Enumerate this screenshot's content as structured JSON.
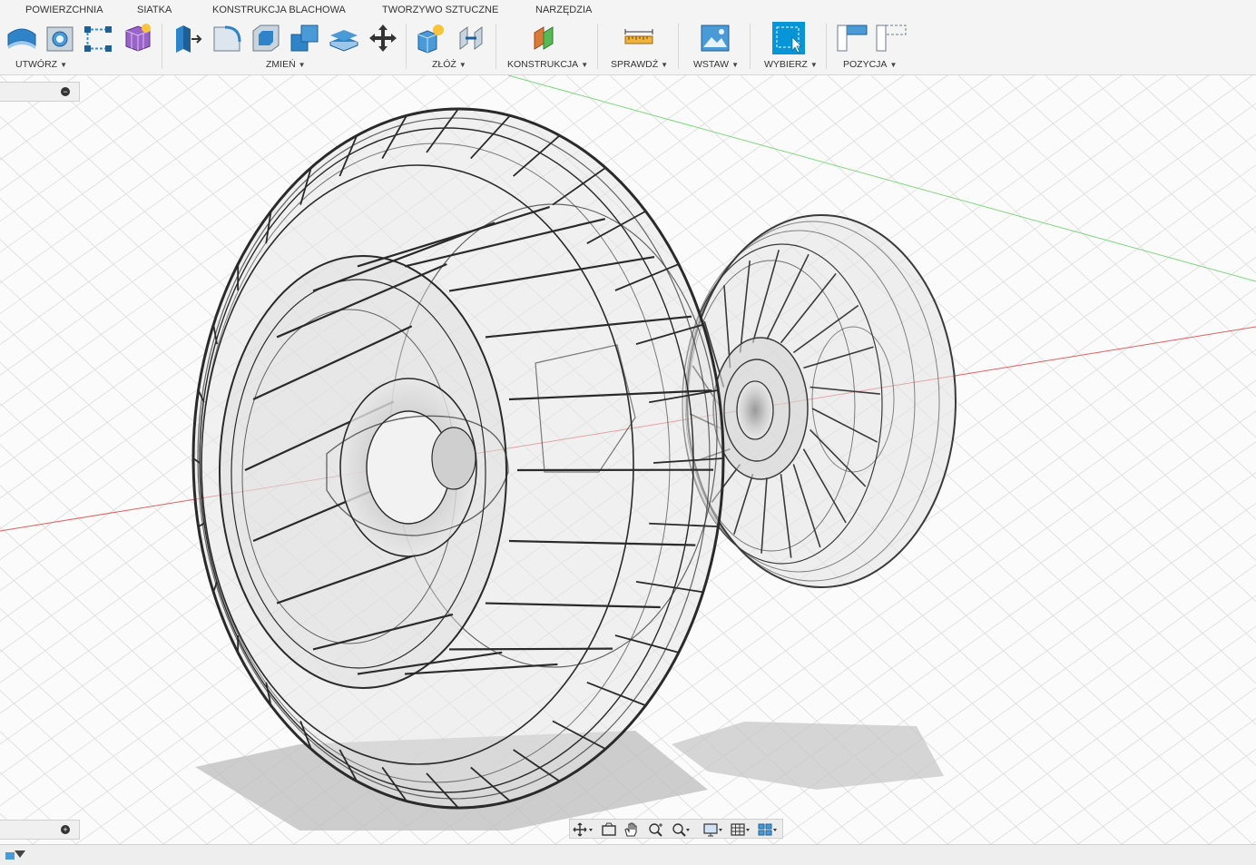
{
  "ribbon": {
    "tabs": [
      "POWIERZCHNIA",
      "SIATKA",
      "KONSTRUKCJA BLACHOWA",
      "TWORZYWO SZTUCZNE",
      "NARZĘDZIA"
    ],
    "groups": {
      "create": "UTWÓRZ",
      "modify": "ZMIEŃ",
      "assemble": "ZŁÓŻ",
      "construct": "KONSTRUKCJA",
      "inspect": "SPRAWDŹ",
      "insert": "WSTAW",
      "select": "WYBIERZ",
      "position": "POZYCJA"
    },
    "accent_color": "#0696d7"
  },
  "panels": {
    "top_button": "−",
    "bottom_button": "+"
  },
  "navbar": {
    "tools": [
      "orbit-icon",
      "look-at-icon",
      "pan-icon",
      "zoom-icon",
      "fit-icon",
      "display-settings-icon",
      "grid-settings-icon",
      "viewports-icon"
    ]
  },
  "colors": {
    "x_axis": "#e06060",
    "y_axis": "#7fd67f",
    "grid": "#dcdcdc",
    "wire": "#2a2a2a"
  }
}
